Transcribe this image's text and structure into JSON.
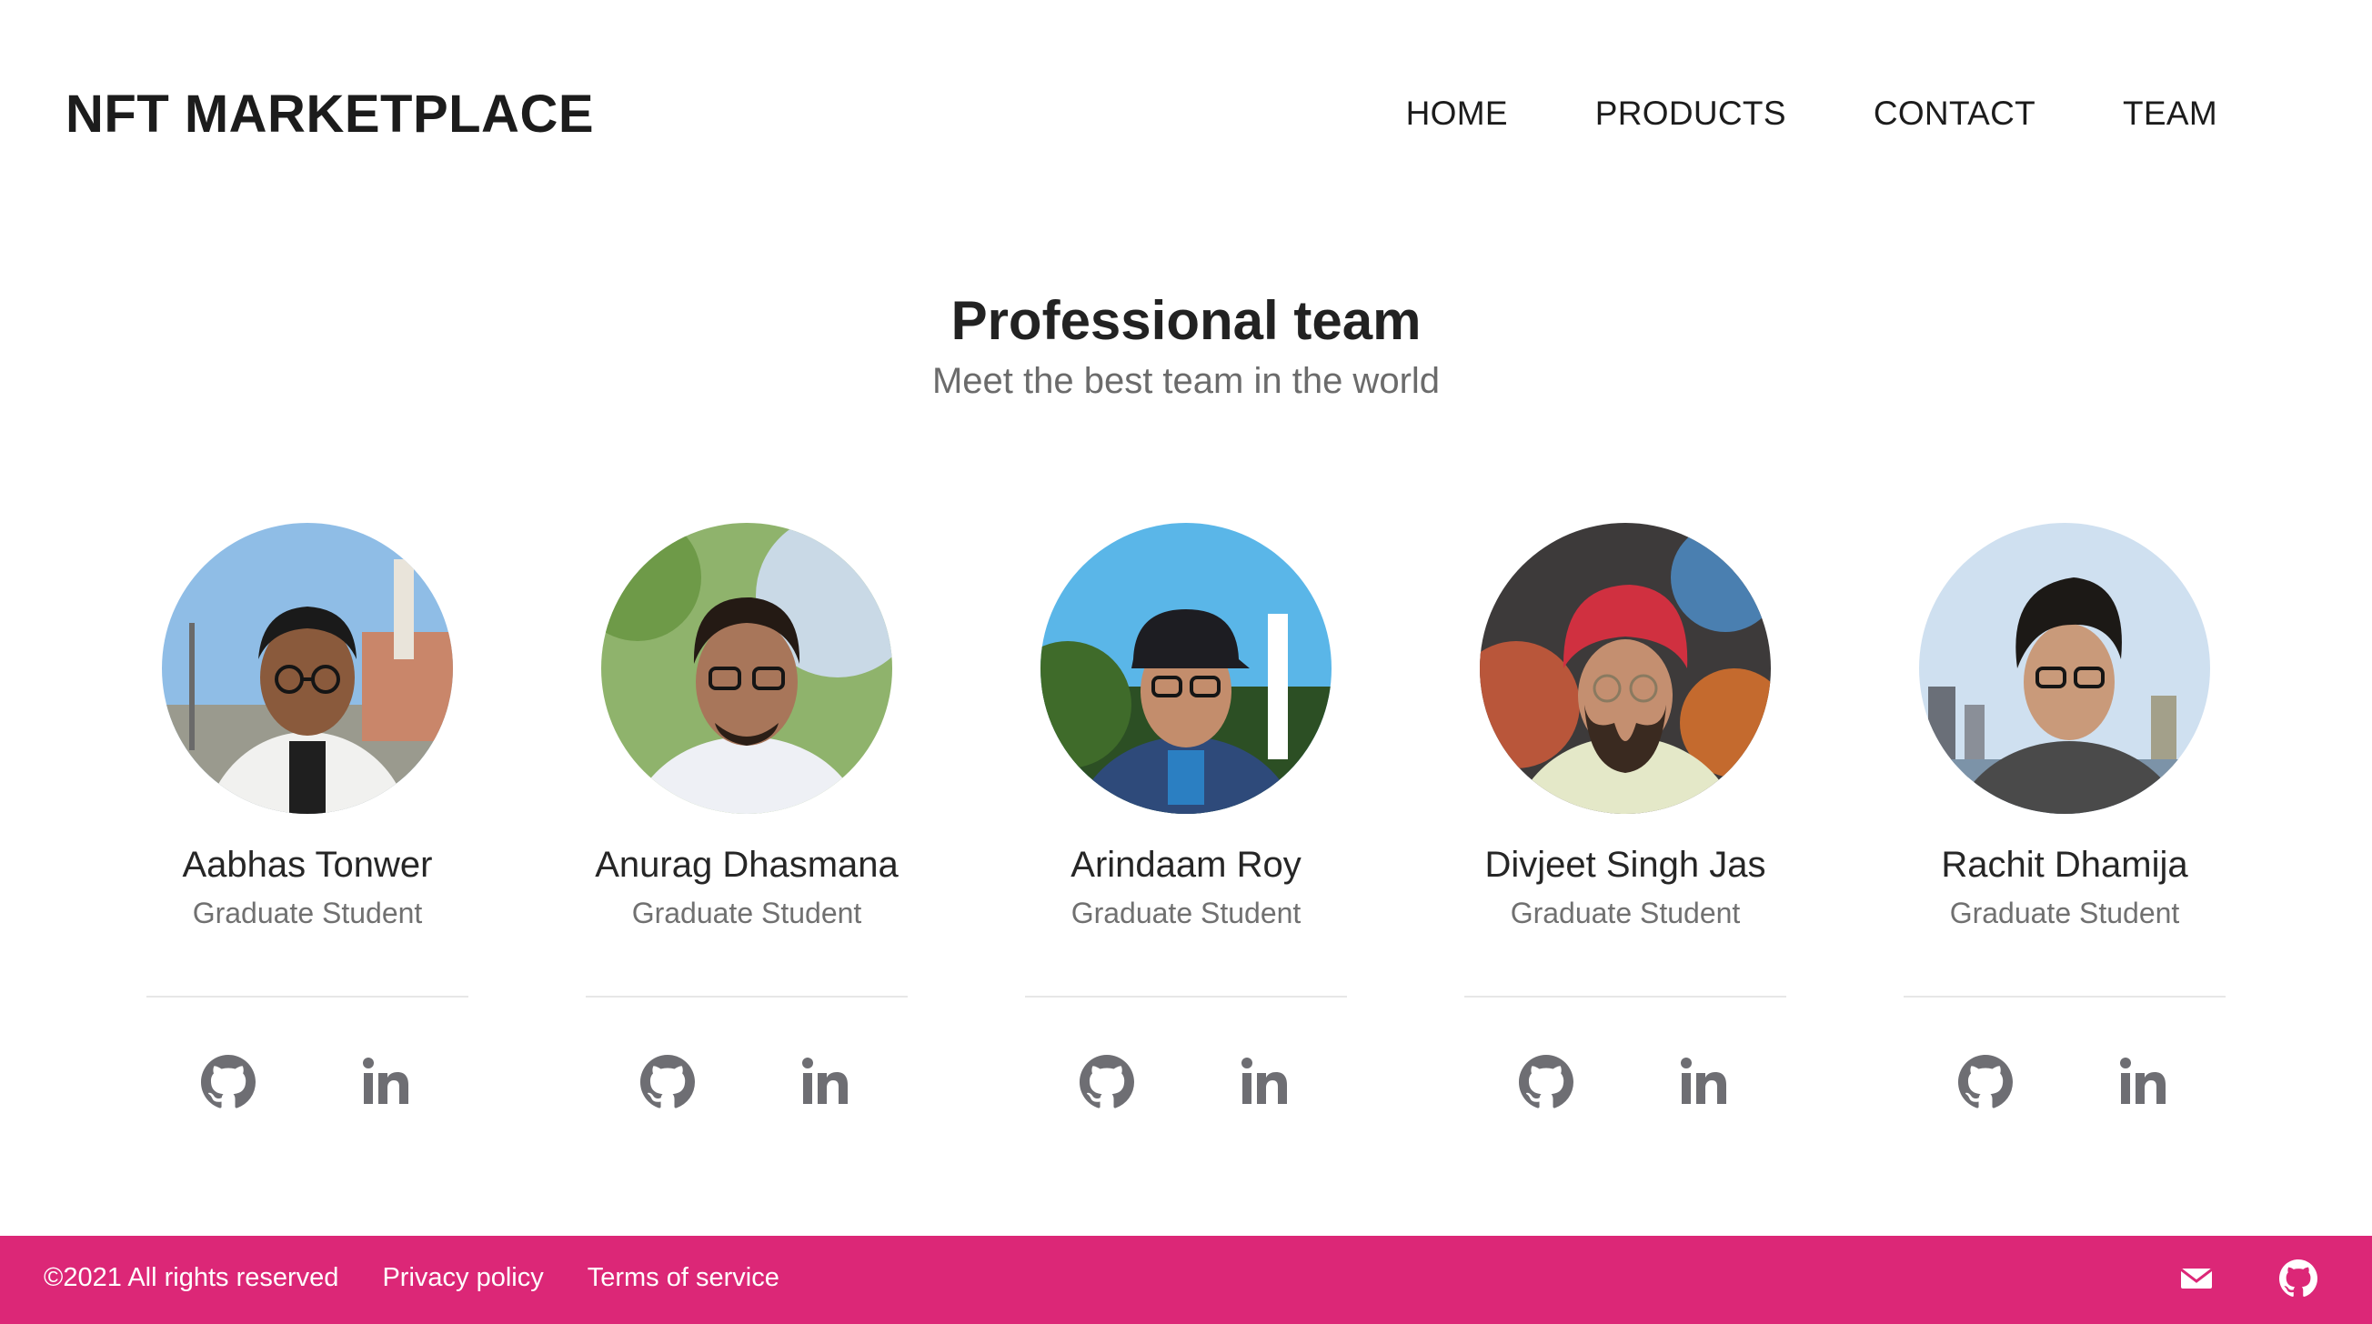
{
  "header": {
    "brand": "NFT MARKETPLACE",
    "nav": [
      "HOME",
      "PRODUCTS",
      "CONTACT",
      "TEAM"
    ]
  },
  "hero": {
    "title": "Professional team",
    "subtitle": "Meet the best team in the world"
  },
  "team": [
    {
      "name": "Aabhas Tonwer",
      "role": "Graduate Student",
      "photo_icon": "person-photo",
      "social_icons": [
        "github-icon",
        "linkedin-icon"
      ]
    },
    {
      "name": "Anurag Dhasmana",
      "role": "Graduate Student",
      "photo_icon": "person-photo",
      "social_icons": [
        "github-icon",
        "linkedin-icon"
      ]
    },
    {
      "name": "Arindaam Roy",
      "role": "Graduate Student",
      "photo_icon": "person-photo",
      "social_icons": [
        "github-icon",
        "linkedin-icon"
      ]
    },
    {
      "name": "Divjeet Singh Jas",
      "role": "Graduate Student",
      "photo_icon": "person-photo",
      "social_icons": [
        "github-icon",
        "linkedin-icon"
      ]
    },
    {
      "name": "Rachit Dhamija",
      "role": "Graduate Student",
      "photo_icon": "person-photo",
      "social_icons": [
        "github-icon",
        "linkedin-icon"
      ]
    }
  ],
  "footer": {
    "copyright": "©2021 All rights reserved",
    "links": [
      "Privacy policy",
      "Terms of service"
    ],
    "icons": [
      "mail-icon",
      "github-icon"
    ]
  },
  "colors": {
    "accent": "#dc2777",
    "text": "#1c1c1c",
    "muted": "#707070",
    "icon": "#6e6e73"
  }
}
